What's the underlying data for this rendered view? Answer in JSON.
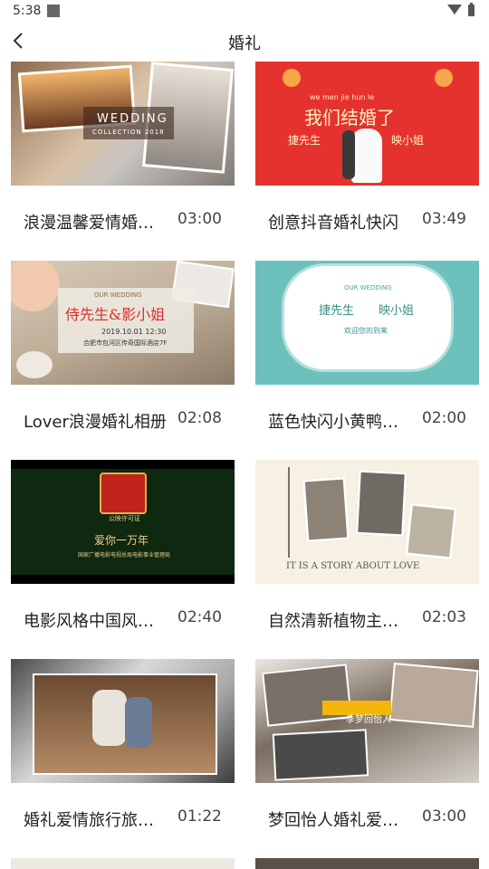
{
  "status": {
    "time": "5:38"
  },
  "header": {
    "title": "婚礼"
  },
  "items": [
    {
      "title": "浪漫温馨爱情婚礼相册",
      "duration": "03:00",
      "texts": {
        "a": "WEDDING",
        "b": "COLLECTION 2018"
      }
    },
    {
      "title": "创意抖音婚礼快闪",
      "duration": "03:49",
      "texts": {
        "a": "we   men   jie   hun   le",
        "b": "我们结婚了",
        "c": "捷先生",
        "d": "映小姐"
      }
    },
    {
      "title": "Lover浪漫婚礼相册",
      "duration": "02:08",
      "texts": {
        "a": "OUR WEDDING",
        "b": "侍先生&影小姐",
        "c": "2019.10.01 12:30",
        "d": "合肥市包河区传奇国际酒店7F"
      }
    },
    {
      "title": "蓝色快闪小黄鸭婚礼",
      "duration": "02:00",
      "texts": {
        "a": "OUR WEDDING",
        "b": "捷先生",
        "c": "映小姐",
        "d": "欢迎您的到来"
      }
    },
    {
      "title": "电影风格中国风婚礼",
      "duration": "02:40",
      "texts": {
        "a": "公映许可证",
        "b": "爱你一万年",
        "c": "国家广播电影电视总局电影事业管理局"
      }
    },
    {
      "title": "自然清新植物主题婚礼",
      "duration": "02:03",
      "texts": {
        "a": "IT IS A STORY ABOUT LOVE"
      }
    },
    {
      "title": "婚礼爱情旅行旅拍相册",
      "duration": "01:22",
      "texts": {}
    },
    {
      "title": "梦回怡人婚礼爱情相册",
      "duration": "03:00",
      "texts": {
        "a": "一季梦回怡人"
      }
    }
  ],
  "colors": {
    "accent": "#e6322e",
    "teal": "#6cc1bd",
    "dark_green": "#0f2810"
  }
}
